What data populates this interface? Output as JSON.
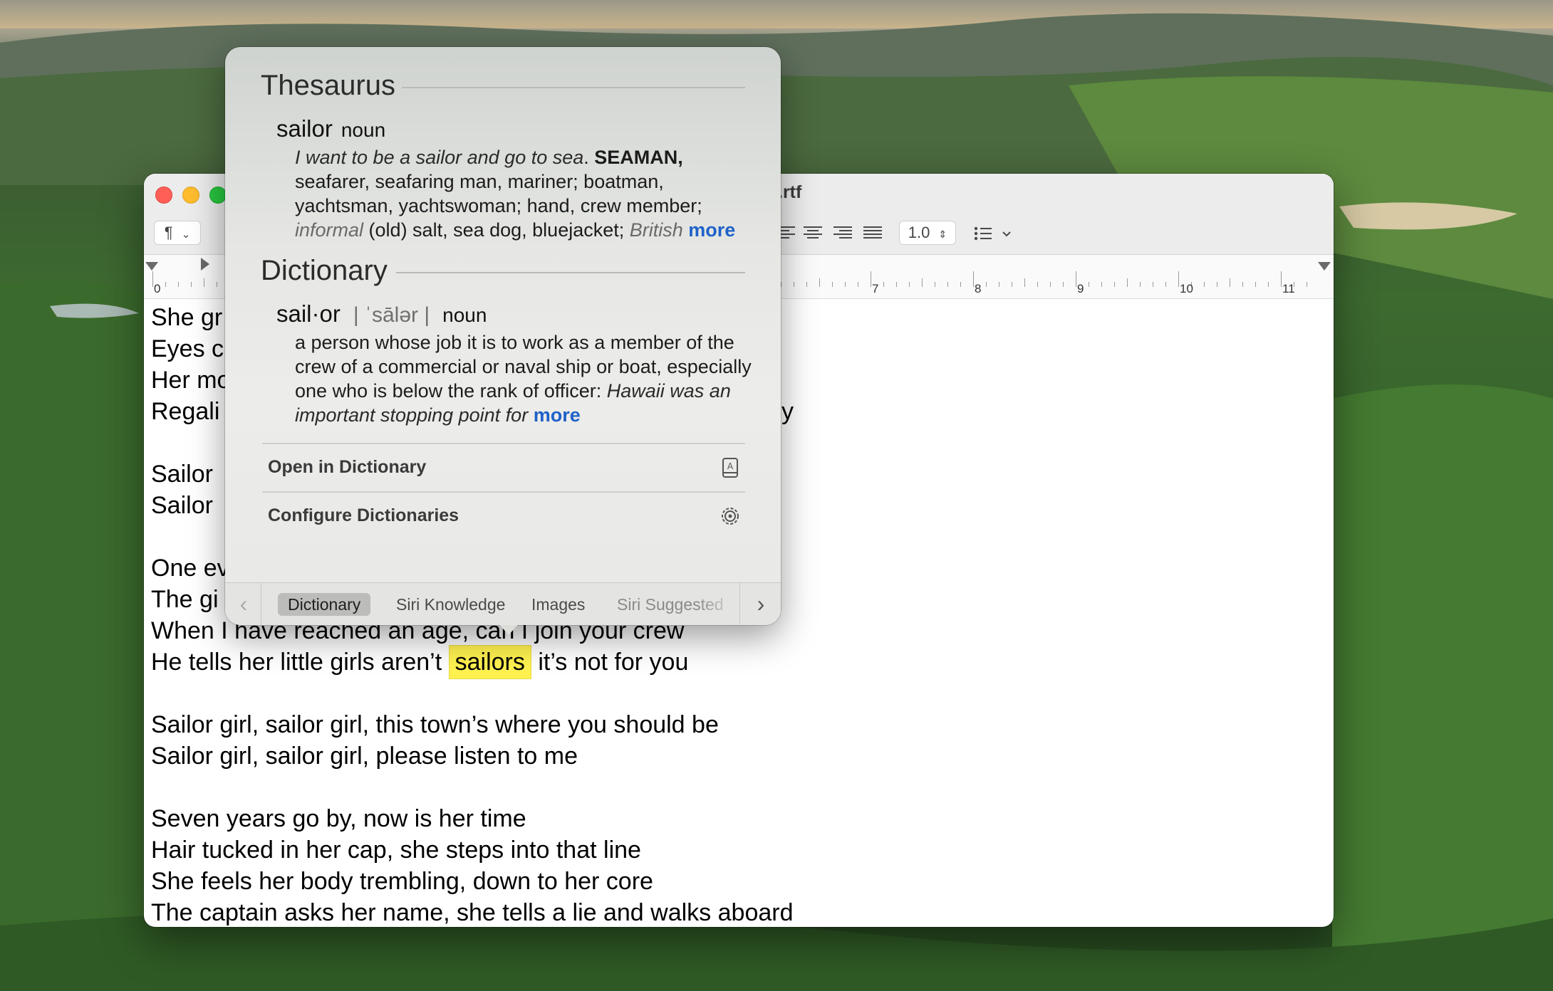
{
  "window": {
    "title_suffix": ".rtf",
    "paragraph_style": "¶",
    "line_spacing": "1.0"
  },
  "ruler": {
    "labels": [
      "0",
      "7",
      "8",
      "9",
      "10",
      "11"
    ]
  },
  "document": {
    "lines": [
      "She gr",
      "Eyes c",
      "Her mo",
      "Regali",
      "",
      "Sailor",
      "Sailor",
      "",
      "One ev",
      "The gi",
      "When I have reached an age, can I join your crew",
      "",
      "",
      "Sailor girl, sailor girl, this town’s where you should be",
      "Sailor girl, sailor girl, please listen to me",
      "",
      "Seven years go by, now is her time",
      "Hair tucked in her cap, she steps into that line",
      "She feels her body trembling, down to her core",
      "The captain asks her name, she tells a lie and walks aboard"
    ],
    "highlight_line": {
      "before": "He tells her little girls aren’t",
      "word": "sailors",
      "after": " it’s not for you"
    },
    "stray_fragment": "y"
  },
  "popover": {
    "thesaurus": {
      "heading": "Thesaurus",
      "word": "sailor",
      "pos": "noun",
      "example": "I want to be a sailor and go to sea",
      "synonyms_bold": "SEAMAN,",
      "synonyms": "seafarer, seafaring man, mariner; boatman, yachtsman, yachtswoman; hand, crew member;",
      "register_label": "informal",
      "informal_synonyms": "(old) salt, sea dog, bluejacket;",
      "region_label": "British",
      "more": "more"
    },
    "dictionary": {
      "heading": "Dictionary",
      "word": "sail·or",
      "pronunciation": "| ˈsālər |",
      "pos": "noun",
      "definition": "a person whose job it is to work as a member of the crew of a commercial or naval ship or boat, especially one who is below the rank of officer:",
      "example": "Hawaii was an important stopping point for",
      "more": "more"
    },
    "actions": {
      "open": "Open in Dictionary",
      "configure": "Configure Dictionaries"
    },
    "tabs": [
      "Dictionary",
      "Siri Knowledge",
      "Images",
      "Siri Suggested"
    ],
    "active_tab": "Dictionary"
  },
  "colors": {
    "highlight": "#fff250",
    "link": "#1f62c9",
    "close": "#ff5f57",
    "minimize": "#febc2e",
    "zoom": "#28c840"
  }
}
